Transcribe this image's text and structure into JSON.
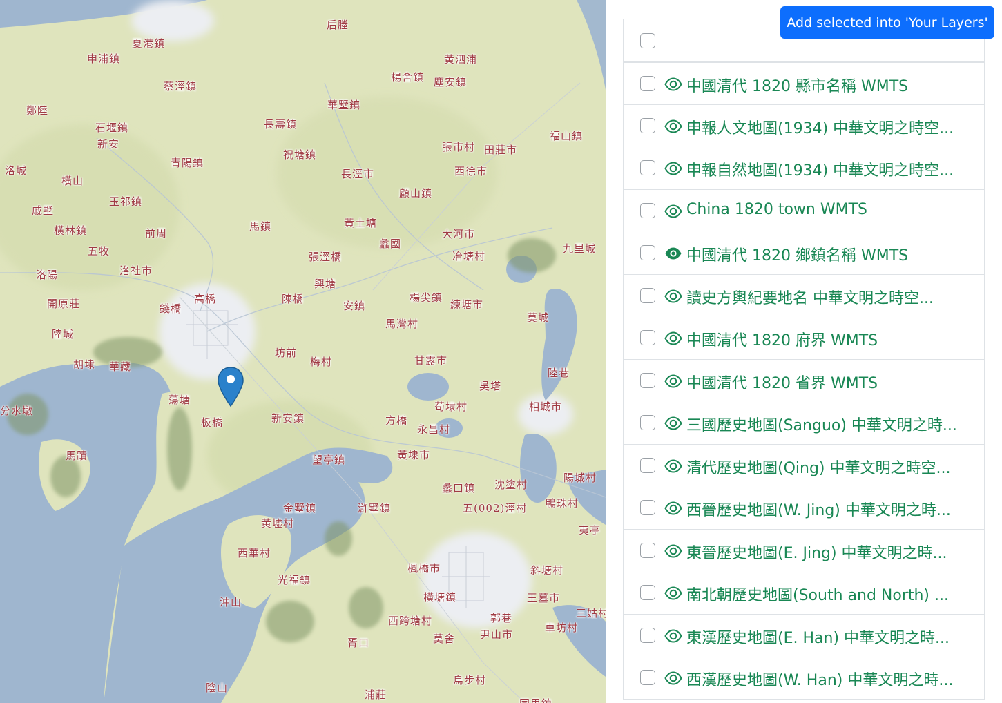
{
  "toolbar": {
    "add_selected_label": "Add selected into 'Your Layers'"
  },
  "layers": [
    {
      "label": "中國清代 1820 縣市名稱 WMTS",
      "checked": false,
      "visible_icon": "eye-outline-icon"
    },
    {
      "label": "申報人文地圖(1934) 中華文明之時空...",
      "checked": false,
      "visible_icon": "eye-outline-icon"
    },
    {
      "label": "申報自然地圖(1934) 中華文明之時空...",
      "checked": false,
      "visible_icon": "eye-outline-icon"
    },
    {
      "label": "China 1820 town WMTS",
      "checked": false,
      "visible_icon": "eye-outline-icon"
    },
    {
      "label": "中國清代 1820 鄉鎮名稱 WMTS",
      "checked": false,
      "visible_icon": "eye-filled-icon"
    },
    {
      "label": "讀史方輿紀要地名 中華文明之時空...",
      "checked": false,
      "visible_icon": "eye-outline-icon"
    },
    {
      "label": "中國清代 1820 府界 WMTS",
      "checked": false,
      "visible_icon": "eye-outline-icon"
    },
    {
      "label": "中國清代 1820 省界 WMTS",
      "checked": false,
      "visible_icon": "eye-outline-icon"
    },
    {
      "label": "三國歷史地圖(Sanguo) 中華文明之時...",
      "checked": false,
      "visible_icon": "eye-outline-icon"
    },
    {
      "label": "清代歷史地圖(Qing) 中華文明之時空...",
      "checked": false,
      "visible_icon": "eye-outline-icon"
    },
    {
      "label": "西晉歷史地圖(W. Jing) 中華文明之時...",
      "checked": false,
      "visible_icon": "eye-outline-icon"
    },
    {
      "label": "東晉歷史地圖(E. Jing) 中華文明之時...",
      "checked": false,
      "visible_icon": "eye-outline-icon"
    },
    {
      "label": "南北朝歷史地圖(South and North) ...",
      "checked": false,
      "visible_icon": "eye-outline-icon"
    },
    {
      "label": "東漢歷史地圖(E. Han) 中華文明之時...",
      "checked": false,
      "visible_icon": "eye-outline-icon"
    },
    {
      "label": "西漢歷史地圖(W. Han) 中華文明之時...",
      "checked": false,
      "visible_icon": "eye-outline-icon"
    }
  ],
  "map": {
    "marker_icon": "map-pin-icon",
    "colors": {
      "land": "#dfe4bd",
      "water": "#9fb6cf",
      "urban": "#eceef2",
      "label": "#a03a43",
      "accent": "#0d6efd",
      "link": "#198754"
    },
    "places": [
      "后塍",
      "夏港鎮",
      "申浦鎮",
      "黃泗浦",
      "楊舍鎮",
      "塵安鎮",
      "蔡涇鎮",
      "華墅鎮",
      "鄭陸",
      "石堰鎮",
      "新安",
      "長壽鎮",
      "張市村",
      "田莊市",
      "福山鎮",
      "祝塘鎮",
      "青陽鎮",
      "長涇市",
      "西徐市",
      "洛城",
      "橫山",
      "顧山鎮",
      "玉祁鎮",
      "戚墅",
      "黃土塘",
      "馬鎮",
      "橫林鎮",
      "前周",
      "蠡國",
      "大河市",
      "九里城",
      "五牧",
      "張涇橋",
      "冶塘村",
      "洛社市",
      "洛陽",
      "興塘",
      "楊尖鎮",
      "陳橋",
      "錢橋",
      "高橋",
      "安鎮",
      "練塘市",
      "開原莊",
      "馬灣村",
      "莫城",
      "陸城",
      "坊前",
      "梅村",
      "甘露市",
      "胡埭",
      "華藏",
      "陸巷",
      "吳塔",
      "蕩塘",
      "苟埭村",
      "相城市",
      "分水墩",
      "板橋",
      "新安鎮",
      "方橋",
      "永昌村",
      "馬蹟",
      "黃埭市",
      "望亭鎮",
      "蠡口鎮",
      "沈塗村",
      "陽城村",
      "金墅鎮",
      "滸墅鎮",
      "五(002)涇村",
      "鴨珠村",
      "黃墟村",
      "夷亭",
      "西華村",
      "楓橋市",
      "斜塘村",
      "光福鎮",
      "橫塘鎮",
      "王墓市",
      "三姑村",
      "沖山",
      "西跨塘村",
      "郭巷",
      "車坊村",
      "胥口",
      "莫舍",
      "尹山市",
      "烏步村",
      "陰山",
      "浦莊",
      "同里鎮"
    ]
  }
}
